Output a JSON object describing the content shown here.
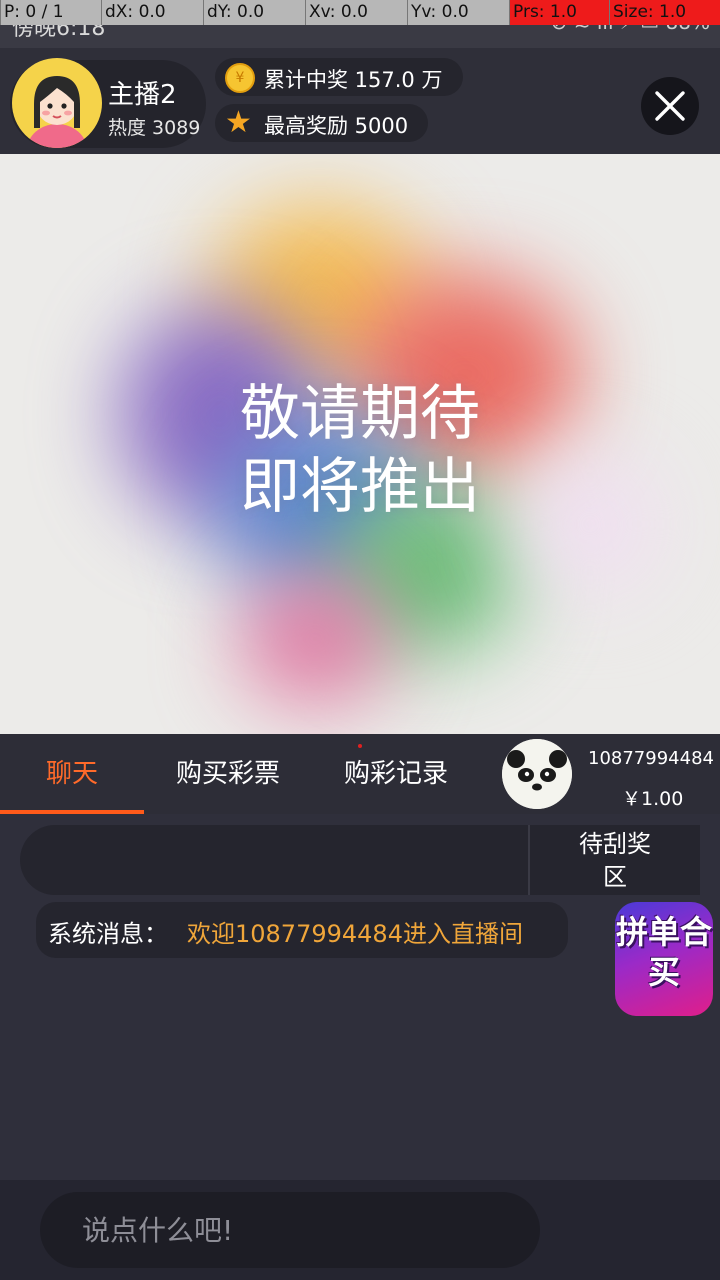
{
  "status_bar": {
    "time": "傍晚6:18",
    "icons_text": "••• ⊘ ≋ ıll ⚡ ▭ 88%"
  },
  "debug_overlay": {
    "fields": [
      "P: 0 / 1",
      "dX: 0.0",
      "dY: 0.0",
      "Xv: 0.0",
      "Yv: 0.0",
      "Prs: 1.0",
      "Size: 1.0"
    ],
    "highlight_color": "#ee1b1b"
  },
  "host": {
    "name": "主播2",
    "heat": "热度 3089"
  },
  "stats": {
    "total_winnings": "累计中奖 157.0 万",
    "max_reward": "最高奖励 5000",
    "coin_symbol": "¥"
  },
  "video": {
    "line1": "敬请期待",
    "line2": "即将推出"
  },
  "tabs": [
    {
      "label": "聊天",
      "active": true
    },
    {
      "label": "购买彩票",
      "active": false
    },
    {
      "label": "购彩记录",
      "active": false
    }
  ],
  "user": {
    "phone": "10877994484",
    "balance": "￥1.00"
  },
  "chat": {
    "scratch_zone": "待刮奖区",
    "system_label": "系统消息：",
    "system_text": "欢迎10877994484进入直播间",
    "group_buy": "拼单合买"
  },
  "input": {
    "placeholder": "说点什么吧!"
  },
  "colors": {
    "accent": "#ff6a2a",
    "system_text": "#f0a63a",
    "background": "#2e2e3a"
  }
}
